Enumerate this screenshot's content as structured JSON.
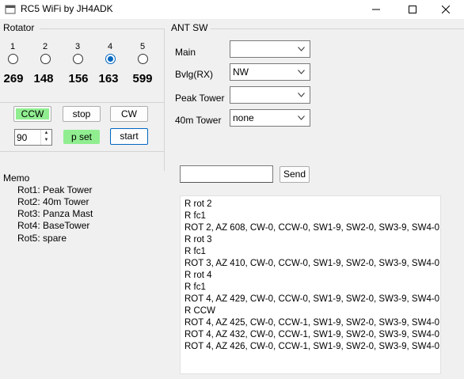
{
  "window": {
    "title": "RC5 WiFi by JH4ADK"
  },
  "rotator": {
    "group_label": "Rotator",
    "units": [
      {
        "num": "1",
        "az": "269",
        "checked": false
      },
      {
        "num": "2",
        "az": "148",
        "checked": false
      },
      {
        "num": "3",
        "az": "156",
        "checked": false
      },
      {
        "num": "4",
        "az": "163",
        "checked": true
      },
      {
        "num": "5",
        "az": "599",
        "checked": false
      }
    ],
    "ccw_label": "CCW",
    "stop_label": "stop",
    "cw_label": "CW",
    "preset_value": "90",
    "pset_label": "p set",
    "start_label": "start"
  },
  "memo": {
    "title": "Memo",
    "items": [
      "Rot1: Peak Tower",
      "Rot2: 40m Tower",
      "Rot3: Panza Mast",
      "Rot4: BaseTower",
      "Rot5: spare"
    ]
  },
  "ant_sw": {
    "group_label": "ANT SW",
    "rows": [
      {
        "label": "Main",
        "value": ""
      },
      {
        "label": "Bvlg(RX)",
        "value": "NW"
      },
      {
        "label": "Peak Tower",
        "value": ""
      },
      {
        "label": "40m Tower",
        "value": "none"
      }
    ]
  },
  "command": {
    "input_value": "",
    "send_label": "Send"
  },
  "log": {
    "lines": [
      "R rot 2",
      "R fc1",
      "ROT 2, AZ 608, CW-0, CCW-0, SW1-9, SW2-0, SW3-9, SW4-0",
      "R rot 3",
      "R fc1",
      "ROT 3, AZ 410, CW-0, CCW-0, SW1-9, SW2-0, SW3-9, SW4-0",
      "R rot 4",
      "R fc1",
      "ROT 4, AZ 429, CW-0, CCW-0, SW1-9, SW2-0, SW3-9, SW4-0",
      "R CCW",
      "ROT 4, AZ 425, CW-0, CCW-1, SW1-9, SW2-0, SW3-9, SW4-0",
      "ROT 4, AZ 432, CW-0, CCW-1, SW1-9, SW2-0, SW3-9, SW4-0",
      "ROT 4, AZ 426, CW-0, CCW-1, SW1-9, SW2-0, SW3-9, SW4-0"
    ]
  },
  "colors": {
    "accent": "#0067c0",
    "green": "#90ee90"
  }
}
